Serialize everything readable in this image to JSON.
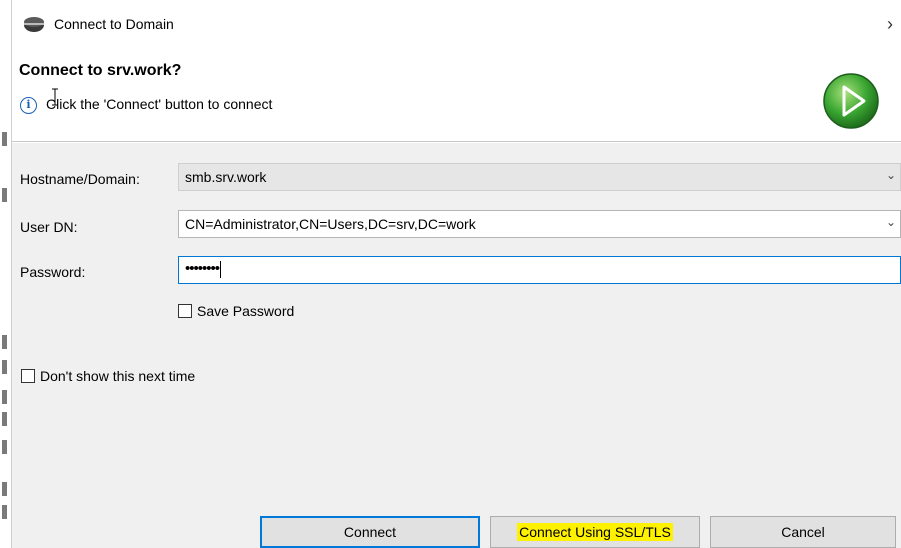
{
  "window": {
    "title": "Connect to Domain",
    "close_glyph": "›"
  },
  "banner": {
    "title": "Connect to srv.work?",
    "message": "Click the 'Connect' button to connect",
    "info_glyph": "i",
    "play_icon": "green-play-circle-icon"
  },
  "form": {
    "hostname": {
      "label": "Hostname/Domain:",
      "value": "smb.srv.work"
    },
    "user_dn": {
      "label": "User DN:",
      "value": "CN=Administrator,CN=Users,DC=srv,DC=work"
    },
    "password": {
      "label": "Password:",
      "masked_value": "••••••••"
    },
    "save_password": {
      "label": "Save Password",
      "checked": false
    },
    "chevron_glyph": "⌄"
  },
  "dont_show": {
    "label": "Don't show this next time",
    "checked": false
  },
  "buttons": {
    "connect": "Connect",
    "connect_ssl": "Connect Using SSL/TLS",
    "cancel": "Cancel"
  },
  "colors": {
    "accent": "#0078d7",
    "highlight": "#fff200",
    "play_green": "#3aa632"
  }
}
